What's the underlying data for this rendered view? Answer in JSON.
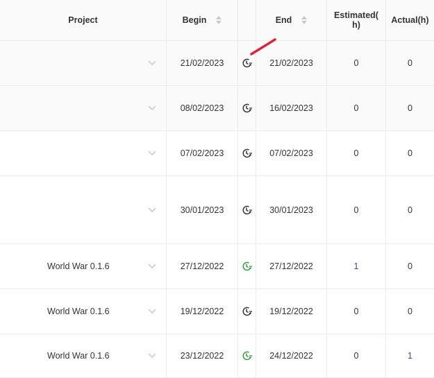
{
  "header": {
    "project": "Project",
    "begin": "Begin",
    "end": "End",
    "estimated_line1": "Estimated(",
    "estimated_line2": "h)",
    "actual": "Actual(h)"
  },
  "rows": [
    {
      "project": "",
      "begin": "21/02/2023",
      "end": "21/02/2023",
      "estimated": "0",
      "actual": "0",
      "clock": "gray"
    },
    {
      "project": "",
      "begin": "08/02/2023",
      "end": "16/02/2023",
      "estimated": "0",
      "actual": "0",
      "clock": "gray"
    },
    {
      "project": "",
      "begin": "07/02/2023",
      "end": "07/02/2023",
      "estimated": "0",
      "actual": "0",
      "clock": "gray"
    },
    {
      "project": "",
      "begin": "30/01/2023",
      "end": "30/01/2023",
      "estimated": "0",
      "actual": "0",
      "clock": "gray"
    },
    {
      "project": "World War 0.1.6",
      "begin": "27/12/2022",
      "end": "27/12/2022",
      "estimated": "1",
      "actual": "0",
      "clock": "green"
    },
    {
      "project": "World War 0.1.6",
      "begin": "19/12/2022",
      "end": "19/12/2022",
      "estimated": "0",
      "actual": "0",
      "clock": "gray"
    },
    {
      "project": "World War 0.1.6",
      "begin": "23/12/2022",
      "end": "24/12/2022",
      "estimated": "0",
      "actual": "1",
      "clock": "green"
    }
  ],
  "colors": {
    "clock_gray": "#333333",
    "clock_green": "#2e9e3a",
    "annotation_red": "#e0233a",
    "estimate_one": "#5a3d8a"
  }
}
